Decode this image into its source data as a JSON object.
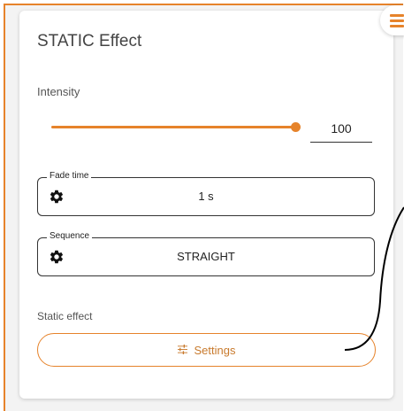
{
  "card": {
    "title": "STATIC Effect",
    "intensity": {
      "label": "Intensity",
      "value": "100",
      "level": 1.0
    },
    "fade_time": {
      "legend": "Fade time",
      "value": "1 s",
      "icon": "gear-icon"
    },
    "sequence": {
      "legend": "Sequence",
      "value": "STRAIGHT",
      "icon": "gear-icon"
    },
    "static_effect": {
      "label": "Static effect",
      "button_label": "Settings",
      "button_icon": "sliders-icon"
    }
  },
  "menu": {
    "icon": "hamburger-menu-icon"
  },
  "colors": {
    "accent": "#e6832b",
    "text": "#222222",
    "background": "#f3f3f3"
  }
}
